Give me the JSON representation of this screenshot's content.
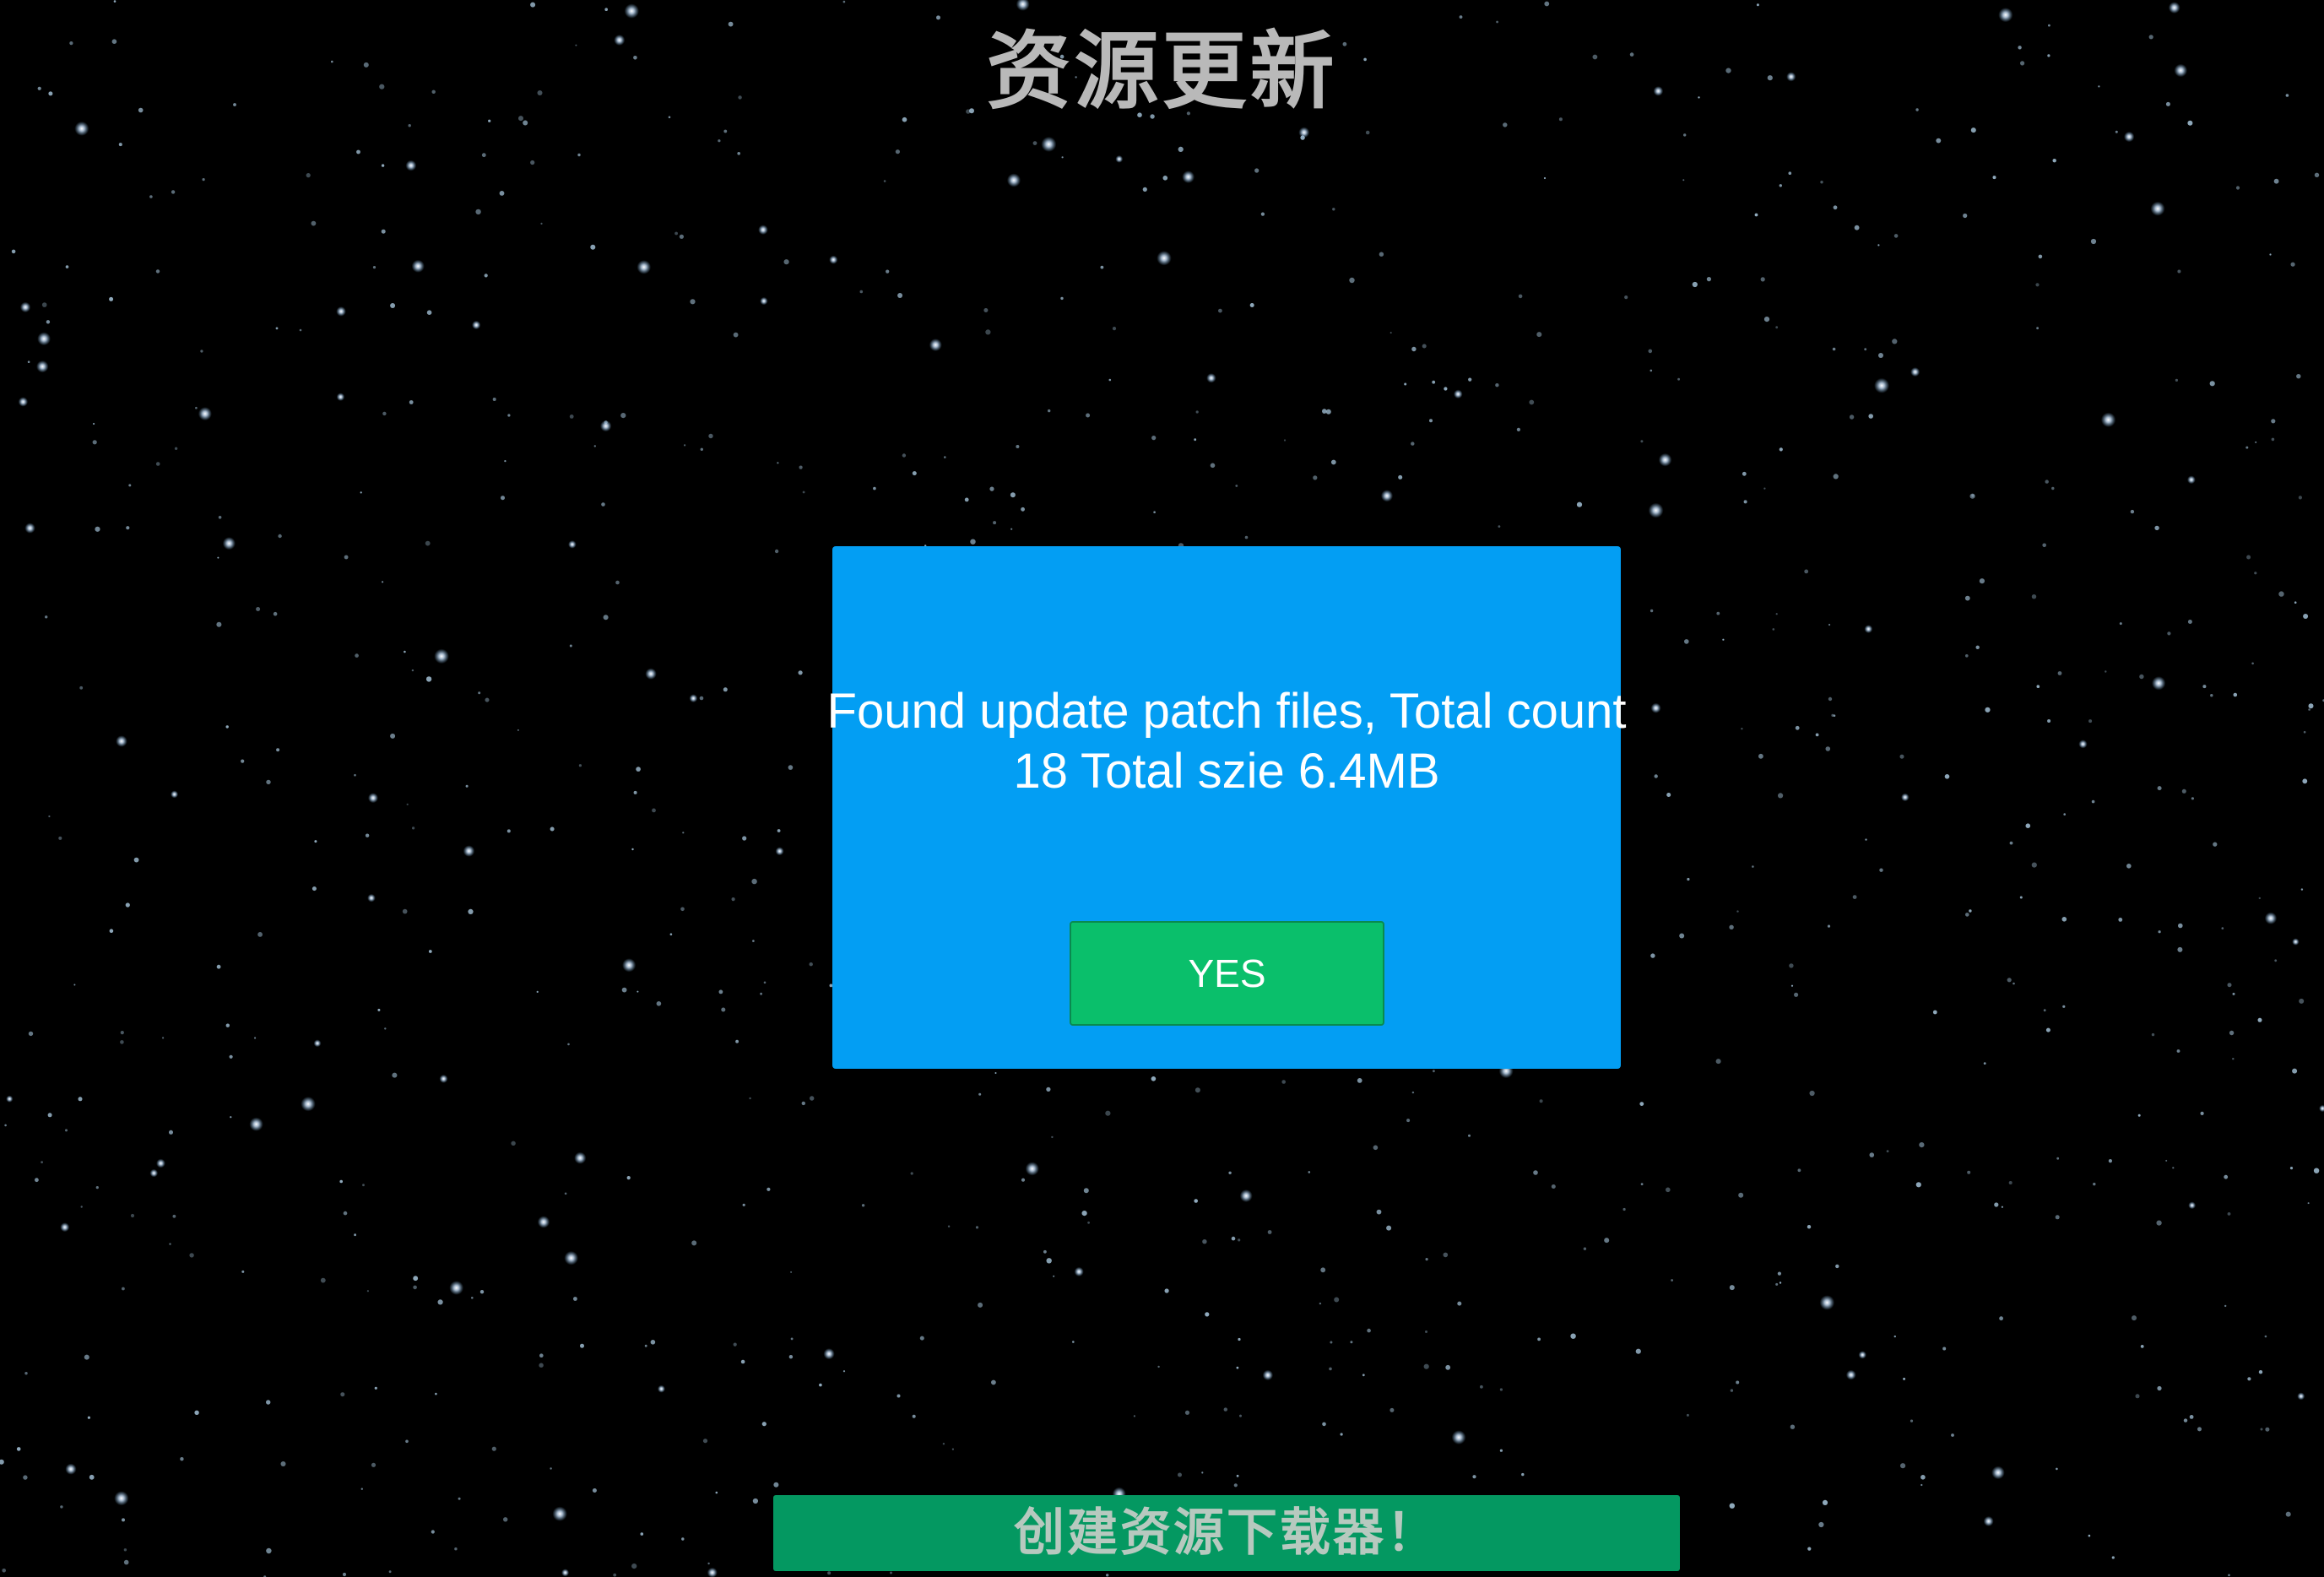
{
  "screen": {
    "title": "资源更新",
    "background": "starfield"
  },
  "dialog": {
    "message": "Found update patch files, Total count\n18 Total szie 6.4MB",
    "yes_label": "YES",
    "colors": {
      "panel": "#039ef3",
      "button": "#0abf6b",
      "text": "#ffffff"
    }
  },
  "footer": {
    "banner_label": "创建资源下载器！",
    "color": "#049861"
  }
}
